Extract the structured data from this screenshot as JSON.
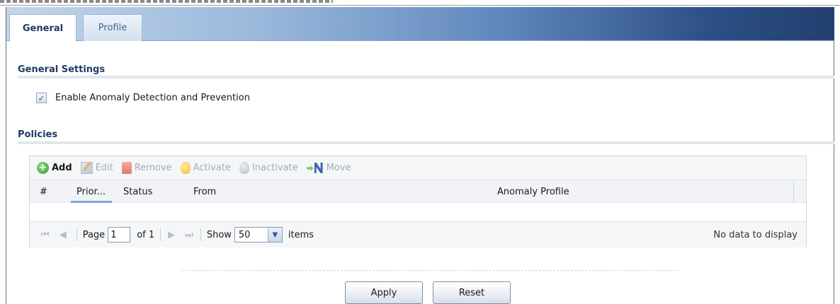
{
  "tabs": [
    {
      "label": "General",
      "active": true
    },
    {
      "label": "Profile",
      "active": false
    }
  ],
  "general_settings": {
    "title": "General Settings",
    "enable_label": "Enable Anomaly Detection and Prevention",
    "enable_checked": true
  },
  "policies": {
    "title": "Policies",
    "toolbar": {
      "add": "Add",
      "edit": "Edit",
      "remove": "Remove",
      "activate": "Activate",
      "inactivate": "Inactivate",
      "move": "Move"
    },
    "columns": [
      "#",
      "Prior...",
      "Status",
      "From",
      "Anomaly Profile"
    ],
    "rows": [],
    "pager": {
      "page_label": "Page",
      "page_value": "1",
      "of_label": "of 1",
      "show_label": "Show",
      "show_value": "50",
      "items_label": "items",
      "status": "No data to display"
    }
  },
  "buttons": {
    "apply": "Apply",
    "reset": "Reset"
  },
  "colors": {
    "tab_active_text": "#1f3b63",
    "tab_inactive_text": "#3b6aa0",
    "section_title": "#1f3b63",
    "header_gradient_end": "#223f6f"
  }
}
